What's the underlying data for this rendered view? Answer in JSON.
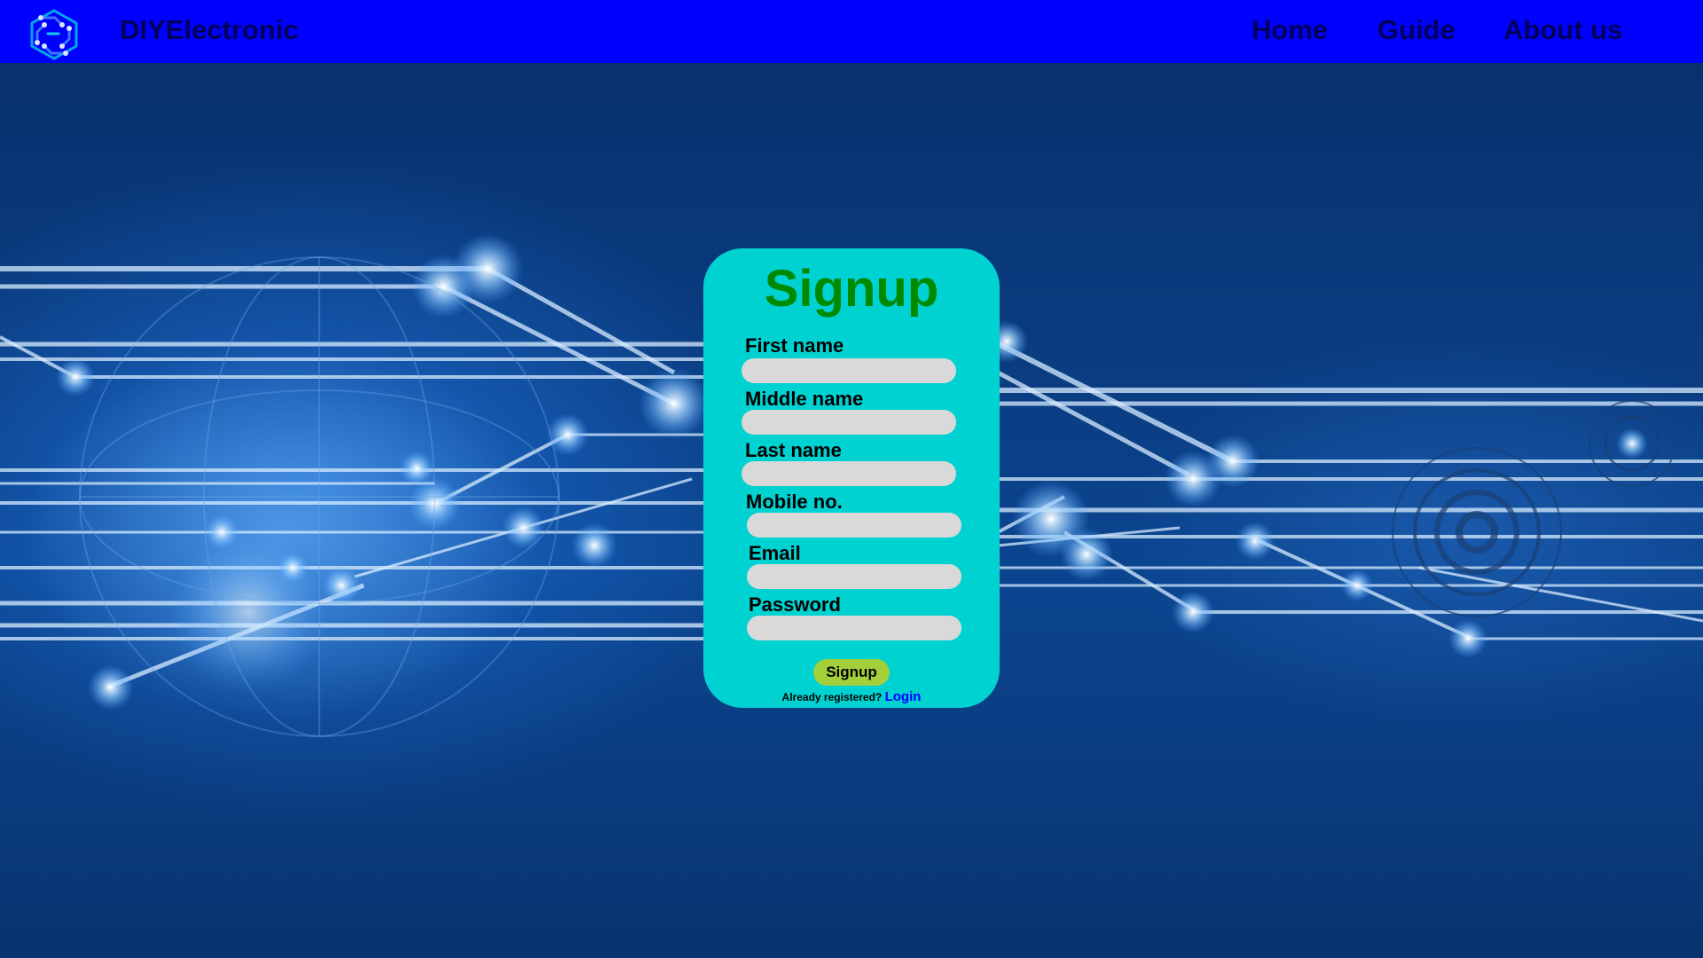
{
  "nav": {
    "brand": "DIYElectronic",
    "links": [
      {
        "label": "Home"
      },
      {
        "label": "Guide"
      },
      {
        "label": "About us"
      }
    ]
  },
  "form": {
    "title": "Signup",
    "fields": [
      {
        "label": "First name",
        "value": "",
        "placeholder": ""
      },
      {
        "label": "Middle name",
        "value": "",
        "placeholder": ""
      },
      {
        "label": "Last name",
        "value": "",
        "placeholder": ""
      },
      {
        "label": "Mobile no.",
        "value": "",
        "placeholder": ""
      },
      {
        "label": "Email",
        "value": "",
        "placeholder": ""
      },
      {
        "label": "Password",
        "value": "",
        "placeholder": ""
      }
    ],
    "submit_label": "Signup",
    "login_prompt": "Already registered?",
    "login_link": "Login"
  },
  "colors": {
    "navbar": "#0000ff",
    "nav_text": "#00005a",
    "card": "#00d1d1",
    "title": "#008a00",
    "input": "#d9d9d9",
    "button": "#a3cf3a",
    "link": "#0000ff"
  },
  "icons": {
    "logo": "circuit-logo-icon"
  }
}
